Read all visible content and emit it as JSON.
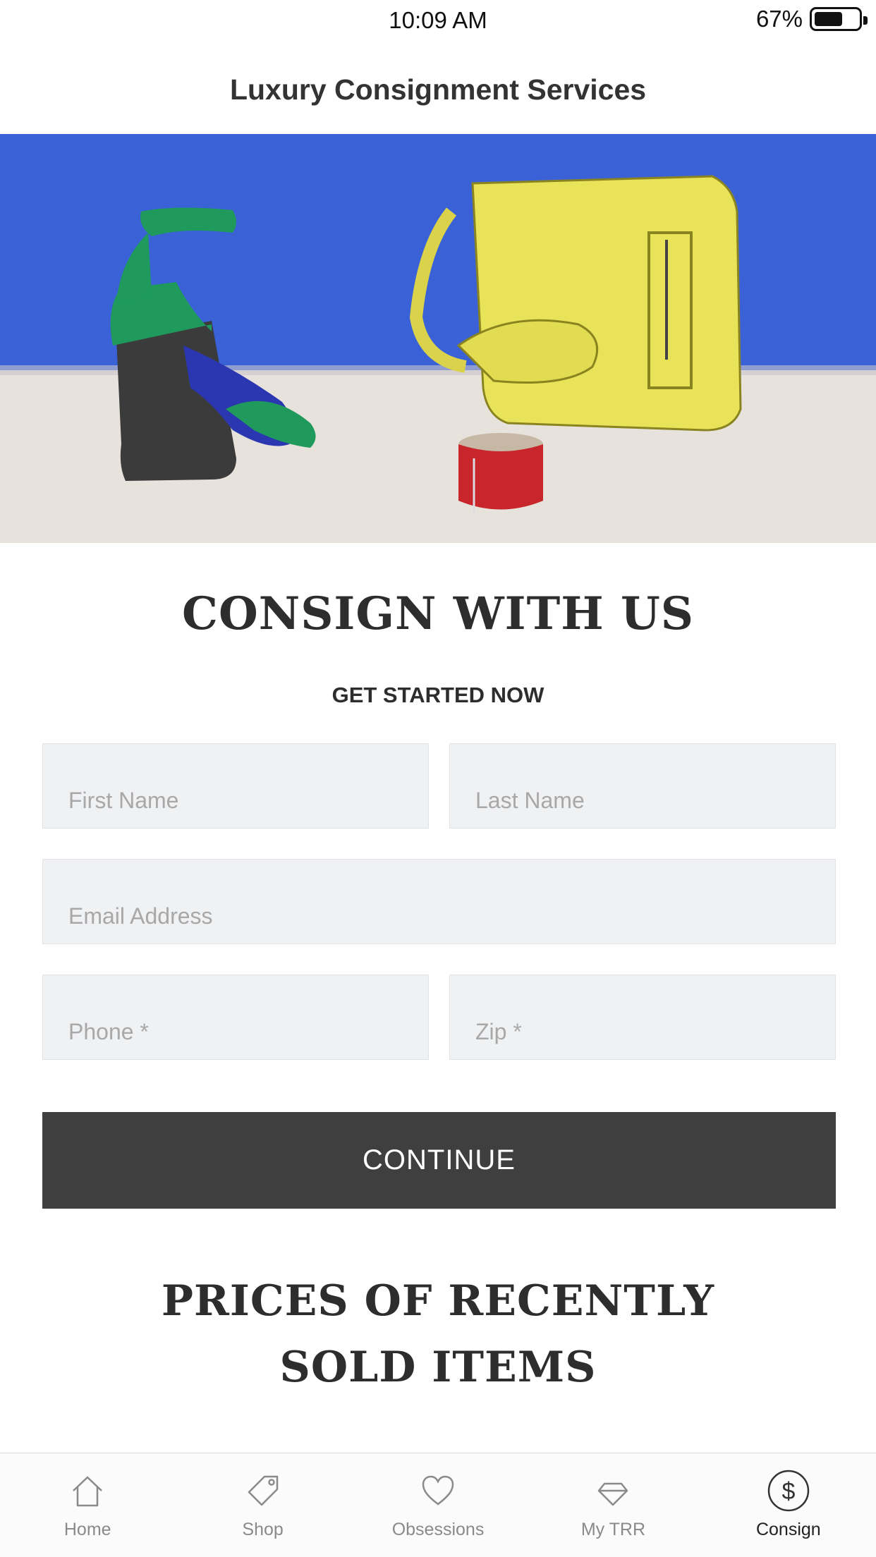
{
  "status_bar": {
    "time": "10:09 AM",
    "battery": "67%",
    "battery_level": 0.67
  },
  "header": {
    "title": "Luxury Consignment Services"
  },
  "hero": {
    "icon": "product-photo"
  },
  "consign": {
    "heading": "CONSIGN WITH US",
    "subheading": "GET STARTED NOW",
    "fields": {
      "first_name": {
        "placeholder": "First Name",
        "value": ""
      },
      "last_name": {
        "placeholder": "Last Name",
        "value": ""
      },
      "email": {
        "placeholder": "Email Address",
        "value": ""
      },
      "phone": {
        "placeholder": "Phone *",
        "value": ""
      },
      "zip": {
        "placeholder": "Zip *",
        "value": ""
      }
    },
    "continue_label": "CONTINUE"
  },
  "prices": {
    "heading_line1": "PRICES OF RECENTLY",
    "heading_line2": "SOLD ITEMS"
  },
  "tab_bar": {
    "items": [
      {
        "label": "Home",
        "icon": "home-icon"
      },
      {
        "label": "Shop",
        "icon": "tag-icon"
      },
      {
        "label": "Obsessions",
        "icon": "heart-icon"
      },
      {
        "label": "My TRR",
        "icon": "diamond-icon"
      },
      {
        "label": "Consign",
        "icon": "dollar-icon",
        "active": true
      }
    ]
  },
  "colors": {
    "button": "#3f3f3f",
    "field_bg": "#f0f1f3",
    "hero_wall": "#3a62d6",
    "hero_floor": "#e8e2dc",
    "bag": "#e9e35a"
  }
}
